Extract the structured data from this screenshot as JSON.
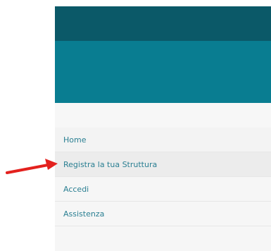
{
  "menu": {
    "items": [
      {
        "label": "Home"
      },
      {
        "label": "Registra la tua Struttura"
      },
      {
        "label": "Accedi"
      },
      {
        "label": "Assistenza"
      }
    ]
  },
  "colors": {
    "topbar": "#0b5968",
    "banner": "#097d91",
    "link": "#2a7f92",
    "annotation_arrow": "#e3211e"
  },
  "annotation": {
    "arrow_points_to": "Registra la tua Struttura"
  }
}
